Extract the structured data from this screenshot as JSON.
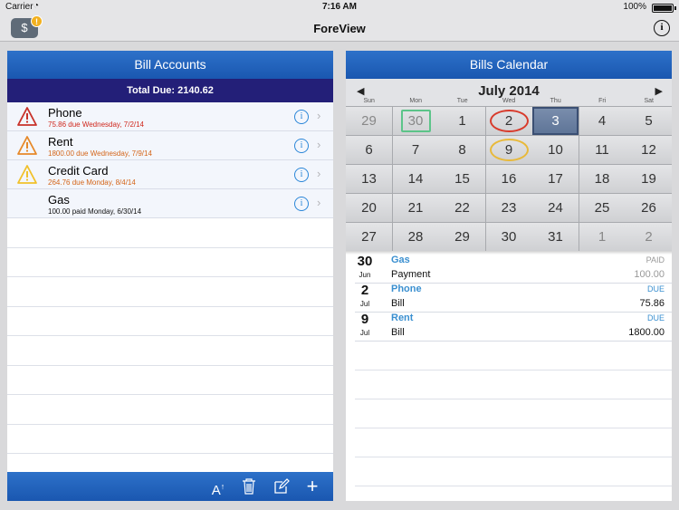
{
  "status": {
    "carrier": "Carrier",
    "time": "7:16 AM",
    "battery": "100%"
  },
  "nav": {
    "title": "ForeView",
    "badge": "!"
  },
  "accounts": {
    "header": "Bill Accounts",
    "total_due": "Total Due: 2140.62",
    "items": [
      {
        "name": "Phone",
        "detail": "75.86 due Wednesday, 7/2/14",
        "level": "danger",
        "detail_color": "#d0281c"
      },
      {
        "name": "Rent",
        "detail": "1800.00 due Wednesday, 7/9/14",
        "level": "warning",
        "detail_color": "#d4661a"
      },
      {
        "name": "Credit Card",
        "detail": "264.76 due Monday, 8/4/14",
        "level": "caution",
        "detail_color": "#d4661a"
      },
      {
        "name": "Gas",
        "detail": "100.00 paid Monday, 6/30/14",
        "level": "none",
        "detail_color": "#111111"
      }
    ],
    "toolbar": [
      "font-size-icon",
      "trash-icon",
      "compose-icon",
      "plus-icon"
    ]
  },
  "calendar": {
    "header": "Bills Calendar",
    "month": "July 2014",
    "weekdays": [
      "Sun",
      "Mon",
      "Tue",
      "Wed",
      "Thu",
      "Fri",
      "Sat"
    ],
    "weeks": [
      [
        "29",
        "30",
        "1",
        "2",
        "3",
        "4",
        "5"
      ],
      [
        "6",
        "7",
        "8",
        "9",
        "10",
        "11",
        "12"
      ],
      [
        "13",
        "14",
        "15",
        "16",
        "17",
        "18",
        "19"
      ],
      [
        "20",
        "21",
        "22",
        "23",
        "24",
        "25",
        "26"
      ],
      [
        "27",
        "28",
        "29",
        "30",
        "31",
        "1",
        "2"
      ]
    ],
    "events": [
      {
        "day": "30",
        "month": "Jun",
        "name": "Gas",
        "status": "PAID",
        "type": "Payment",
        "amount": "100.00"
      },
      {
        "day": "2",
        "month": "Jul",
        "name": "Phone",
        "status": "DUE",
        "type": "Bill",
        "amount": "75.86"
      },
      {
        "day": "9",
        "month": "Jul",
        "name": "Rent",
        "status": "DUE",
        "type": "Bill",
        "amount": "1800.00"
      }
    ]
  }
}
